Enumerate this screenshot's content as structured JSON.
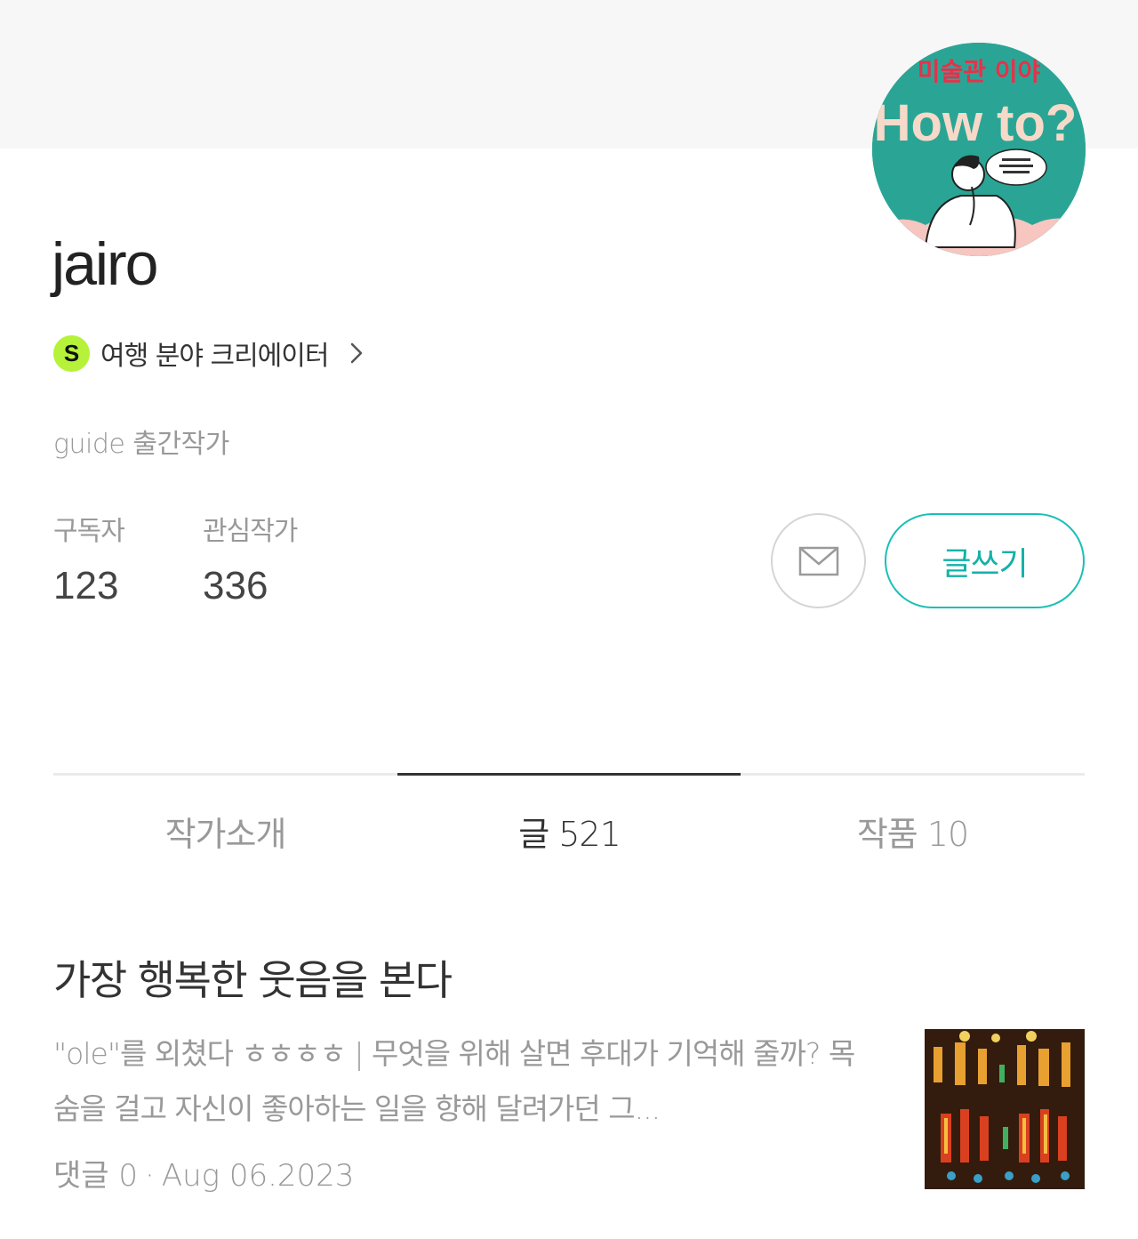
{
  "profile": {
    "name": "jairo",
    "creator_label": "여행 분야 크리에이터",
    "creator_badge_letter": "S",
    "description": "guide 출간작가",
    "avatar_title": "How to?",
    "avatar_top_text": "미술관 이야"
  },
  "stats": {
    "subscribers_label": "구독자",
    "subscribers_value": "123",
    "following_label": "관심작가",
    "following_value": "336"
  },
  "buttons": {
    "mail_icon": "mail-icon",
    "write_label": "글쓰기"
  },
  "tabs": [
    {
      "label": "작가소개"
    },
    {
      "label": "글 521"
    },
    {
      "label": "작품 10"
    }
  ],
  "active_tab": 1,
  "posts": [
    {
      "title": "가장 행복한 웃음을 본다",
      "excerpt": "\"ole\"를 외쳤다 ㅎㅎㅎㅎ | 무엇을 위해 살면 후대가 기억해 줄까?  목숨을 걸고 자신이 좋아하는 일을 향해 달려가던 그...",
      "comments": "댓글 0",
      "date": "Aug 06.2023"
    }
  ],
  "colors": {
    "accent": "#1bbfb6",
    "badge": "#b6f23a",
    "cover": "#f7f7f7"
  }
}
